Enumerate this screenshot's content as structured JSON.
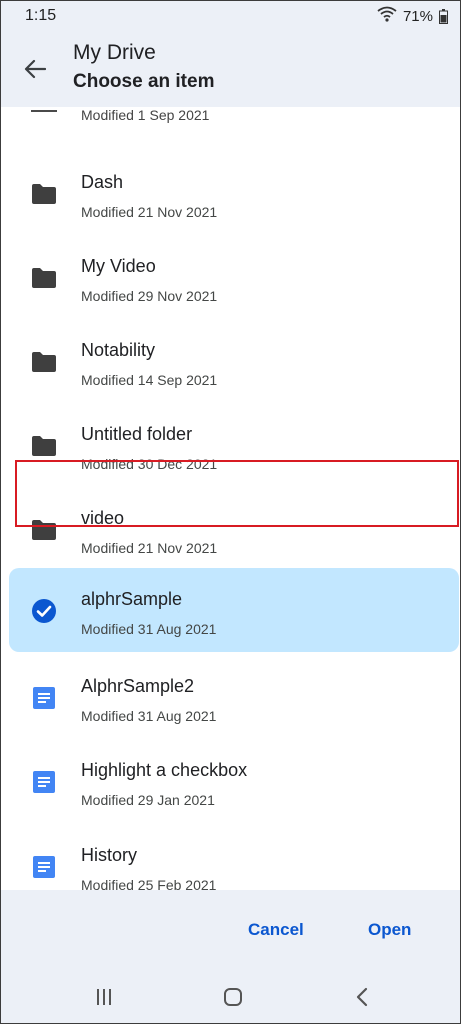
{
  "status_bar": {
    "time": "1:15",
    "battery": "71%"
  },
  "app_bar": {
    "title": "My Drive",
    "subtitle": "Choose an item"
  },
  "partial_item": {
    "meta": "Modified 1 Sep 2021"
  },
  "items": [
    {
      "name": "Dash",
      "meta": "Modified 21 Nov 2021",
      "icon": "folder-icon"
    },
    {
      "name": "My Video",
      "meta": "Modified 29 Nov 2021",
      "icon": "folder-icon"
    },
    {
      "name": "Notability",
      "meta": "Modified 14 Sep 2021",
      "icon": "folder-icon"
    },
    {
      "name": "Untitled folder",
      "meta": "Modified 30 Dec 2021",
      "icon": "folder-icon"
    },
    {
      "name": "video",
      "meta": "Modified 21 Nov 2021",
      "icon": "folder-icon"
    },
    {
      "name": "alphrSample",
      "meta": "Modified 31 Aug 2021",
      "icon": "check-circle-icon",
      "selected": true
    },
    {
      "name": "AlphrSample2",
      "meta": "Modified 31 Aug 2021",
      "icon": "doc-icon"
    },
    {
      "name": "Highlight a checkbox",
      "meta": "Modified 29 Jan 2021",
      "icon": "doc-icon"
    },
    {
      "name": "History",
      "meta": "Modified 25 Feb 2021",
      "icon": "doc-icon"
    }
  ],
  "actions": {
    "cancel": "Cancel",
    "open": "Open"
  },
  "colors": {
    "accent": "#0b57d0",
    "selected_bg": "#c2e7ff",
    "surface": "#ecf0f7",
    "annotation": "#d81b23",
    "doc_blue": "#4285f4"
  }
}
